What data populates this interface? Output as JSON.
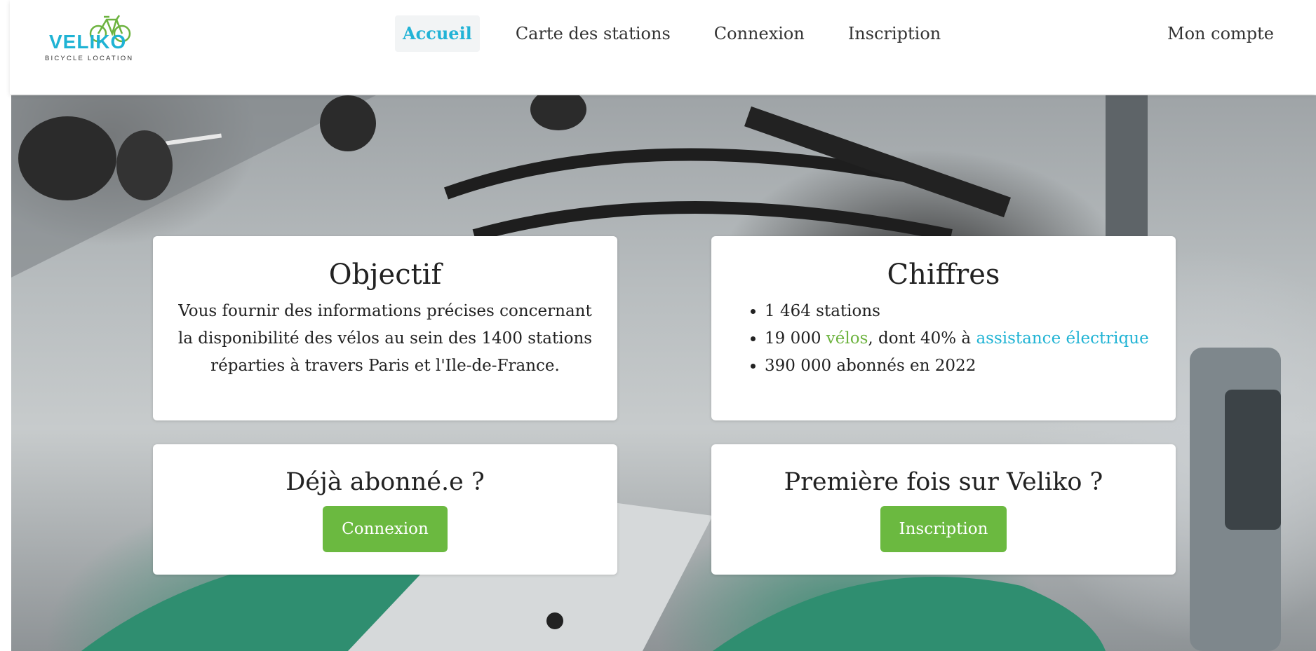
{
  "logo": {
    "word": "VELIKO",
    "tagline": "BICYCLE LOCATION",
    "icon": "bicycle-icon"
  },
  "nav": {
    "items": [
      "Accueil",
      "Carte des stations",
      "Connexion",
      "Inscription"
    ],
    "active": "Accueil",
    "account": "Mon compte"
  },
  "objectif": {
    "title": "Objectif",
    "text": "Vous fournir des informations précises concernant la disponibilité des vélos au sein des 1400 stations réparties à travers Paris et l'Ile-de-France."
  },
  "chiffres": {
    "title": "Chiffres",
    "line1": "1 464 stations",
    "line2_prefix": "19 000 ",
    "line2_link": "vélos",
    "line2_mid": ", dont 40% à ",
    "line2_link2": "assistance électrique",
    "line3": "390 000 abonnés en 2022"
  },
  "abonne": {
    "title": "Déjà abonné.e ?",
    "button": "Connexion"
  },
  "premiere": {
    "title": "Première fois sur Veliko ?",
    "button": "Inscription"
  },
  "colors": {
    "accent_cyan": "#1fb3d4",
    "accent_green": "#6bb940",
    "nav_active_bg": "#f2f4f5"
  }
}
